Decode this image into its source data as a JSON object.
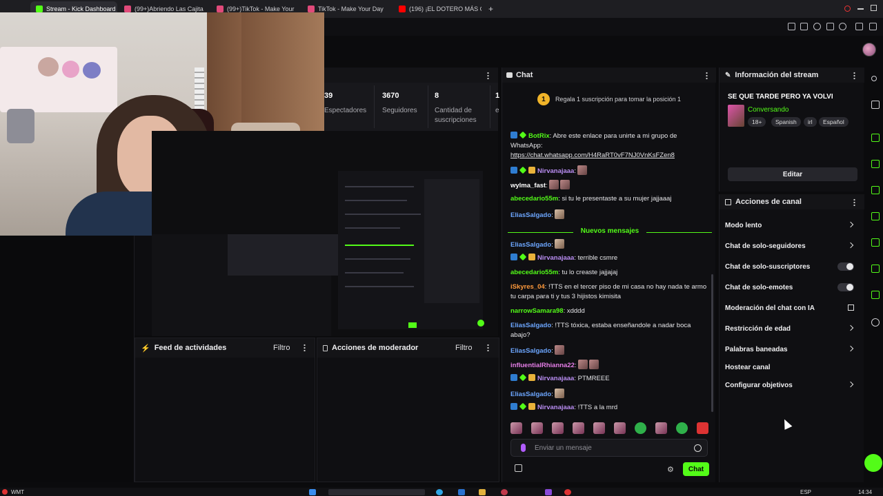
{
  "browser": {
    "tabs": [
      {
        "label": "Stream - Kick Dashboard",
        "color": "#53fc18",
        "active": true
      },
      {
        "label": "(99+)Abriendo Las Cajita",
        "color": "#111111"
      },
      {
        "label": "(99+)TikTok - Make Your",
        "color": "#111111"
      },
      {
        "label": "TikTok - Make Your Day",
        "color": "#111111"
      },
      {
        "label": "(196) ¡EL DOTERO MÁS C",
        "color": "#ff0000"
      }
    ],
    "new_tab": "+"
  },
  "stats": {
    "items": [
      {
        "value": "39",
        "label": "Espectadores"
      },
      {
        "value": "3670",
        "label": "Seguidores"
      },
      {
        "value": "8",
        "label": "Cantidad de suscripciones"
      },
      {
        "value": "1",
        "label": "e"
      }
    ]
  },
  "panels": {
    "feed": {
      "title": "Feed de actividades",
      "filter": "Filtro"
    },
    "mod": {
      "title": "Acciones de moderador",
      "filter": "Filtro"
    }
  },
  "chat": {
    "title": "Chat",
    "banner_num": "1",
    "banner_text": "Regala 1 suscripción para tomar la posición 1",
    "messages": [
      {
        "user": "BotRix",
        "user_color": "#53fc18",
        "text": ": Abre este enlace para unirte a mi grupo de WhatsApp:"
      },
      {
        "user": "",
        "user_color": "#ffffff",
        "text": "https://chat.whatsapp.com/H4RaRT0vF7NJ0VnKsFZen8"
      },
      {
        "user": "Nirvanajaaa",
        "user_color": "#b98df2",
        "text": ":"
      },
      {
        "user": "wylma_fast",
        "user_color": "#ffffff",
        "text": ":"
      },
      {
        "user": "abecedario55m",
        "user_color": "#53fc18",
        "text": ": si tu le presentaste a su mujer jajjaaaj"
      },
      {
        "user": "EliasSalgado",
        "user_color": "#6ca6ff",
        "text": ":"
      },
      {
        "user": "EliasSalgado",
        "user_color": "#6ca6ff",
        "text": ":"
      },
      {
        "user": "Nirvanajaaa",
        "user_color": "#b98df2",
        "text": ": terrible csmre"
      },
      {
        "user": "abecedario55m",
        "user_color": "#53fc18",
        "text": ": tu lo creaste jajjajaj"
      },
      {
        "user": "iSkyres_04",
        "user_color": "#ff9a3c",
        "text": ": !TTS en el tercer piso de mi casa no hay nada te armo tu carpa para ti y tus 3 hijistos kimisita"
      },
      {
        "user": "narrowSamara98",
        "user_color": "#53fc18",
        "text": ": xdddd"
      },
      {
        "user": "EliasSalgado",
        "user_color": "#6ca6ff",
        "text": ": !TTS tóxica, estaba enseñandole a nadar boca abajo?"
      },
      {
        "user": "EliasSalgado",
        "user_color": "#6ca6ff",
        "text": ":"
      },
      {
        "user": "influentialRhianna22",
        "user_color": "#e67ee8",
        "text": ":"
      },
      {
        "user": "Nirvanajaaa",
        "user_color": "#b98df2",
        "text": ": PTMREEE"
      },
      {
        "user": "EliasSalgado",
        "user_color": "#6ca6ff",
        "text": ":"
      },
      {
        "user": "Nirvanajaaa",
        "user_color": "#b98df2",
        "text": ": !TTS a la mrd"
      }
    ],
    "new_messages": "Nuevos mensajes",
    "input_placeholder": "Enviar un mensaje",
    "send_label": "Chat"
  },
  "stream_info": {
    "title": "Información del stream",
    "stream_title": "SE QUE TARDE PERO YA VOLVI",
    "category": "Conversando",
    "tags": [
      "18+",
      "Spanish",
      "irl",
      "Español"
    ],
    "edit_label": "Editar"
  },
  "channel_actions": {
    "title": "Acciones de canal",
    "items": [
      {
        "label": "Modo lento",
        "control": "chevron"
      },
      {
        "label": "Chat de solo-seguidores",
        "control": "chevron"
      },
      {
        "label": "Chat de solo-suscriptores",
        "control": "toggle"
      },
      {
        "label": "Chat de solo-emotes",
        "control": "toggle"
      },
      {
        "label": "Moderación del chat con IA",
        "control": "external"
      },
      {
        "label": "Restricción de edad",
        "control": "chevron"
      },
      {
        "label": "Palabras baneadas",
        "control": "chevron"
      },
      {
        "label": "Hostear canal",
        "control": "none"
      },
      {
        "label": "Configurar objetivos",
        "control": "chevron"
      }
    ]
  },
  "taskbar": {
    "left_label": "WMT",
    "lang": "ESP",
    "time": "14:34"
  },
  "colors": {
    "accent": "#53fc18",
    "bg": "#0f0f12",
    "panel_head": "#141417"
  }
}
